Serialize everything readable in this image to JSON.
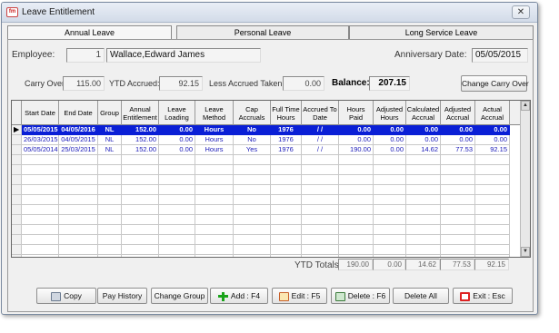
{
  "window": {
    "title": "Leave Entitlement",
    "app_icon": "fm",
    "close_glyph": "✕"
  },
  "tabs": [
    "Annual Leave",
    "Personal Leave",
    "Long Service Leave"
  ],
  "employee": {
    "label": "Employee:",
    "id": "1",
    "name": "Wallace,Edward James"
  },
  "anniversary": {
    "label": "Anniversary Date:",
    "value": "05/05/2015"
  },
  "summary": {
    "carry_over_label": "Carry Over:",
    "carry_over": "115.00",
    "ytd_accrued_label": "YTD Accrued:",
    "ytd_accrued": "92.15",
    "less_taken_label": "Less Accrued Taken:",
    "less_taken": "0.00",
    "balance_label": "Balance:",
    "balance": "207.15",
    "change_button": "Change Carry Over"
  },
  "grid": {
    "indicator": "▶",
    "columns": [
      "Start Date",
      "End Date",
      "Group",
      "Annual Entitlement",
      "Leave Loading",
      "Leave Method",
      "Cap Accruals",
      "Full Time Hours",
      "Accrued To Date",
      "Hours Paid",
      "Adjusted Hours",
      "Calculated Accrual",
      "Adjusted Accrual",
      "Actual Accrual"
    ],
    "rows": [
      [
        "05/05/2015",
        "04/05/2016",
        "NL",
        "152.00",
        "0.00",
        "Hours",
        "No",
        "1976",
        " / /",
        "0.00",
        "0.00",
        "0.00",
        "0.00",
        "0.00"
      ],
      [
        "26/03/2015",
        "04/05/2015",
        "NL",
        "152.00",
        "0.00",
        "Hours",
        "No",
        "1976",
        " / /",
        "0.00",
        "0.00",
        "0.00",
        "0.00",
        "0.00"
      ],
      [
        "05/05/2014",
        "25/03/2015",
        "NL",
        "152.00",
        "0.00",
        "Hours",
        "Yes",
        "1976",
        " / /",
        "190.00",
        "0.00",
        "14.62",
        "77.53",
        "92.15"
      ]
    ],
    "empty_rows": 11
  },
  "totals": {
    "label": "YTD Totals:",
    "values": [
      "190.00",
      "0.00",
      "14.62",
      "77.53",
      "92.15"
    ]
  },
  "buttons": {
    "copy": "Copy",
    "pay_history": "Pay History",
    "change_group": "Change Group",
    "add": "Add : F4",
    "edit": "Edit : F5",
    "delete": "Delete : F6",
    "delete_all": "Delete All",
    "exit": "Exit : Esc"
  },
  "scroll": {
    "up": "▲",
    "down": "▼"
  }
}
